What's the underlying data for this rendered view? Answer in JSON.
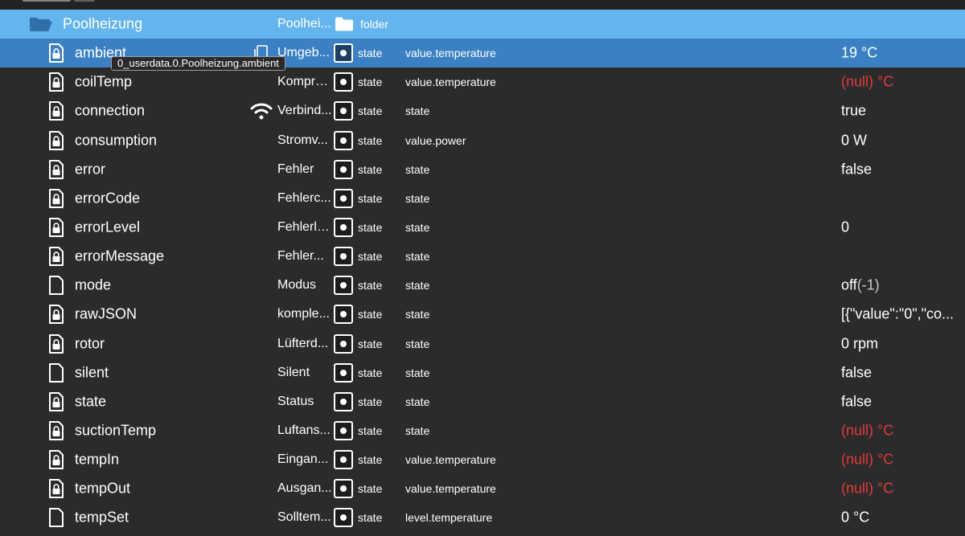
{
  "folder": {
    "name": "Poolheizung",
    "description": "Poolhei...",
    "type": "folder"
  },
  "tooltip": "0_userdata.0.Poolheizung.ambient",
  "rows": [
    {
      "name": "ambient",
      "description": "Umgeb...",
      "type": "state",
      "role": "value.temperature",
      "value": "19 °C",
      "icon": "locked-file-icon",
      "side_icon": "copy-icon",
      "selected": true
    },
    {
      "name": "coilTemp",
      "description": "Kompre...",
      "type": "state",
      "role": "value.temperature",
      "value_null": "(null)",
      "value_unit": " °C",
      "icon": "locked-file-icon"
    },
    {
      "name": "connection",
      "description": "Verbind...",
      "type": "state",
      "role": "state",
      "value": "true",
      "icon": "locked-file-icon",
      "side_icon": "wifi-icon"
    },
    {
      "name": "consumption",
      "description": "Stromv...",
      "type": "state",
      "role": "value.power",
      "value": "0 W",
      "icon": "locked-file-icon"
    },
    {
      "name": "error",
      "description": "Fehler",
      "type": "state",
      "role": "state",
      "value": "false",
      "icon": "locked-file-icon"
    },
    {
      "name": "errorCode",
      "description": "Fehlerc...",
      "type": "state",
      "role": "state",
      "value": "",
      "icon": "locked-file-icon"
    },
    {
      "name": "errorLevel",
      "description": "Fehlerle...",
      "type": "state",
      "role": "state",
      "value": "0",
      "icon": "locked-file-icon"
    },
    {
      "name": "errorMessage",
      "description": "Fehler...",
      "type": "state",
      "role": "state",
      "value": "",
      "icon": "locked-file-icon"
    },
    {
      "name": "mode",
      "description": "Modus",
      "type": "state",
      "role": "state",
      "value": "off",
      "value_code": "(-1)",
      "icon": "file-icon"
    },
    {
      "name": "rawJSON",
      "description": "komple...",
      "type": "state",
      "role": "state",
      "value": "[{\"value\":\"0\",\"co...",
      "icon": "locked-file-icon"
    },
    {
      "name": "rotor",
      "description": "Lüfterd...",
      "type": "state",
      "role": "state",
      "value": "0 rpm",
      "icon": "locked-file-icon"
    },
    {
      "name": "silent",
      "description": "Silent",
      "type": "state",
      "role": "state",
      "value": "false",
      "icon": "file-icon"
    },
    {
      "name": "state",
      "description": "Status",
      "type": "state",
      "role": "state",
      "value": "false",
      "icon": "locked-file-icon"
    },
    {
      "name": "suctionTemp",
      "description": "Luftans...",
      "type": "state",
      "role": "state",
      "value_null": "(null)",
      "value_unit": " °C",
      "icon": "locked-file-icon"
    },
    {
      "name": "tempIn",
      "description": "Eingan...",
      "type": "state",
      "role": "value.temperature",
      "value_null": "(null)",
      "value_unit": " °C",
      "icon": "locked-file-icon"
    },
    {
      "name": "tempOut",
      "description": "Ausgan...",
      "type": "state",
      "role": "value.temperature",
      "value_null": "(null)",
      "value_unit": " °C",
      "icon": "locked-file-icon"
    },
    {
      "name": "tempSet",
      "description": "Solltem...",
      "type": "state",
      "role": "level.temperature",
      "value": "0 °C",
      "icon": "file-icon"
    }
  ]
}
